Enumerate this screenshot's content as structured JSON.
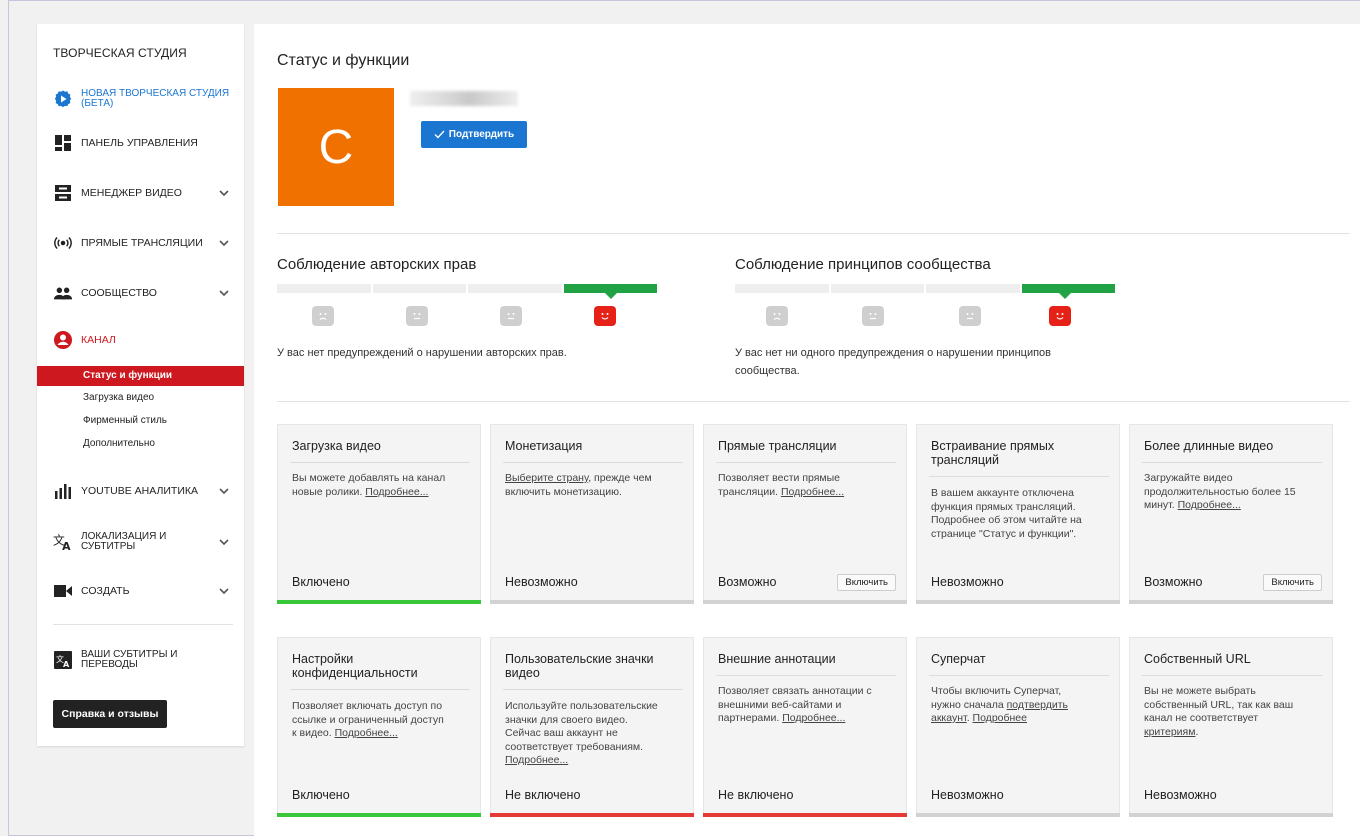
{
  "sidebar": {
    "title": "ТВОРЧЕСКАЯ СТУДИЯ",
    "items": [
      {
        "label": "НОВАЯ ТВОРЧЕСКАЯ СТУДИЯ (БЕТА)",
        "icon": "gear-play-icon",
        "color": "#1b76d2"
      },
      {
        "label": "ПАНЕЛЬ УПРАВЛЕНИЯ",
        "icon": "dashboard-icon"
      },
      {
        "label": "МЕНЕДЖЕР ВИДЕО",
        "icon": "video-manager-icon"
      },
      {
        "label": "ПРЯМЫЕ ТРАНСЛЯЦИИ",
        "icon": "live-icon"
      },
      {
        "label": "СООБЩЕСТВО",
        "icon": "community-icon"
      },
      {
        "label": "КАНАЛ",
        "icon": "channel-icon",
        "color": "#cc181e"
      },
      {
        "label": "YOUTUBE АНАЛИТИКА",
        "icon": "analytics-icon"
      },
      {
        "label": "ЛОКАЛИЗАЦИЯ И СУБТИТРЫ",
        "icon": "translate-icon"
      },
      {
        "label": "СОЗДАТЬ",
        "icon": "create-icon"
      },
      {
        "label": "ВАШИ СУБТИТРЫ И ПЕРЕВОДЫ",
        "icon": "subtitles-icon"
      }
    ],
    "channel_sub": [
      "Статус и функции",
      "Загрузка видео",
      "Фирменный стиль",
      "Дополнительно"
    ],
    "help_label": "Справка и отзывы"
  },
  "main": {
    "title": "Статус и функции",
    "avatar_letter": "C",
    "confirm_label": "Подтвердить",
    "copyright": {
      "title": "Соблюдение авторских прав",
      "text": "У вас нет предупреждений о нарушении авторских прав."
    },
    "community": {
      "title": "Соблюдение принципов сообщества",
      "text_l1": "У вас нет ни одного предупреждения о нарушении принципов",
      "text_l2": "сообщества."
    },
    "cards": [
      {
        "title": "Загрузка видео",
        "desc": [
          "Вы можете добавлять на канал",
          "новые ролики. ",
          "Подробнее..."
        ],
        "status": "Включено",
        "bar": "green"
      },
      {
        "title": "Монетизация",
        "desc": [
          "Выберите страну",
          ", прежде чем",
          "включить монетизацию."
        ],
        "status": "Невозможно",
        "bar": "grey"
      },
      {
        "title": "Прямые трансляции",
        "desc": [
          "Позволяет вести прямые",
          "трансляции. ",
          "Подробнее..."
        ],
        "status": "Возможно",
        "button": "Включить",
        "bar": "grey"
      },
      {
        "title": "Встраивание прямых трансляций",
        "desc": [
          "В вашем аккаунте отключена",
          "функция прямых трансляций.",
          "Подробнее об этом читайте на",
          "странице \"Статус и функции\"."
        ],
        "status": "Невозможно",
        "bar": "grey"
      },
      {
        "title": "Более длинные видео",
        "desc": [
          "Загружайте видео",
          "продолжительностью более 15",
          "минут. ",
          "Подробнее..."
        ],
        "status": "Возможно",
        "button": "Включить",
        "bar": "grey"
      },
      {
        "title": "Настройки конфиденциальности",
        "desc": [
          "Позволяет включать доступ по",
          "ссылке и ограниченный доступ",
          "к видео. ",
          "Подробнее..."
        ],
        "status": "Включено",
        "bar": "green"
      },
      {
        "title": "Пользовательские значки видео",
        "desc": [
          "Используйте пользовательские",
          "значки для своего видео.",
          "Сейчас ваш аккаунт не",
          "соответствует требованиям.",
          "Подробнее..."
        ],
        "status": "Не включено",
        "bar": "red"
      },
      {
        "title": "Внешние аннотации",
        "desc": [
          "Позволяет связать аннотации с",
          "внешними веб-сайтами и",
          "партнерами. ",
          "Подробнее..."
        ],
        "status": "Не включено",
        "bar": "red"
      },
      {
        "title": "Суперчат",
        "desc": [
          "Чтобы включить Суперчат,",
          "нужно сначала ",
          "подтвердить",
          "аккаунт",
          ". ",
          "Подробнее"
        ],
        "status": "Невозможно",
        "bar": "grey"
      },
      {
        "title": "Собственный URL",
        "desc": [
          "Вы не можете выбрать",
          "собственный URL, так как ваш",
          "канал не соответствует",
          "критериям",
          "."
        ],
        "status": "Невозможно",
        "bar": "grey"
      }
    ]
  },
  "colors": {
    "accent_blue": "#1b76d2",
    "brand_red": "#cc181e",
    "green": "#21a245",
    "avatar": "#f07000"
  }
}
